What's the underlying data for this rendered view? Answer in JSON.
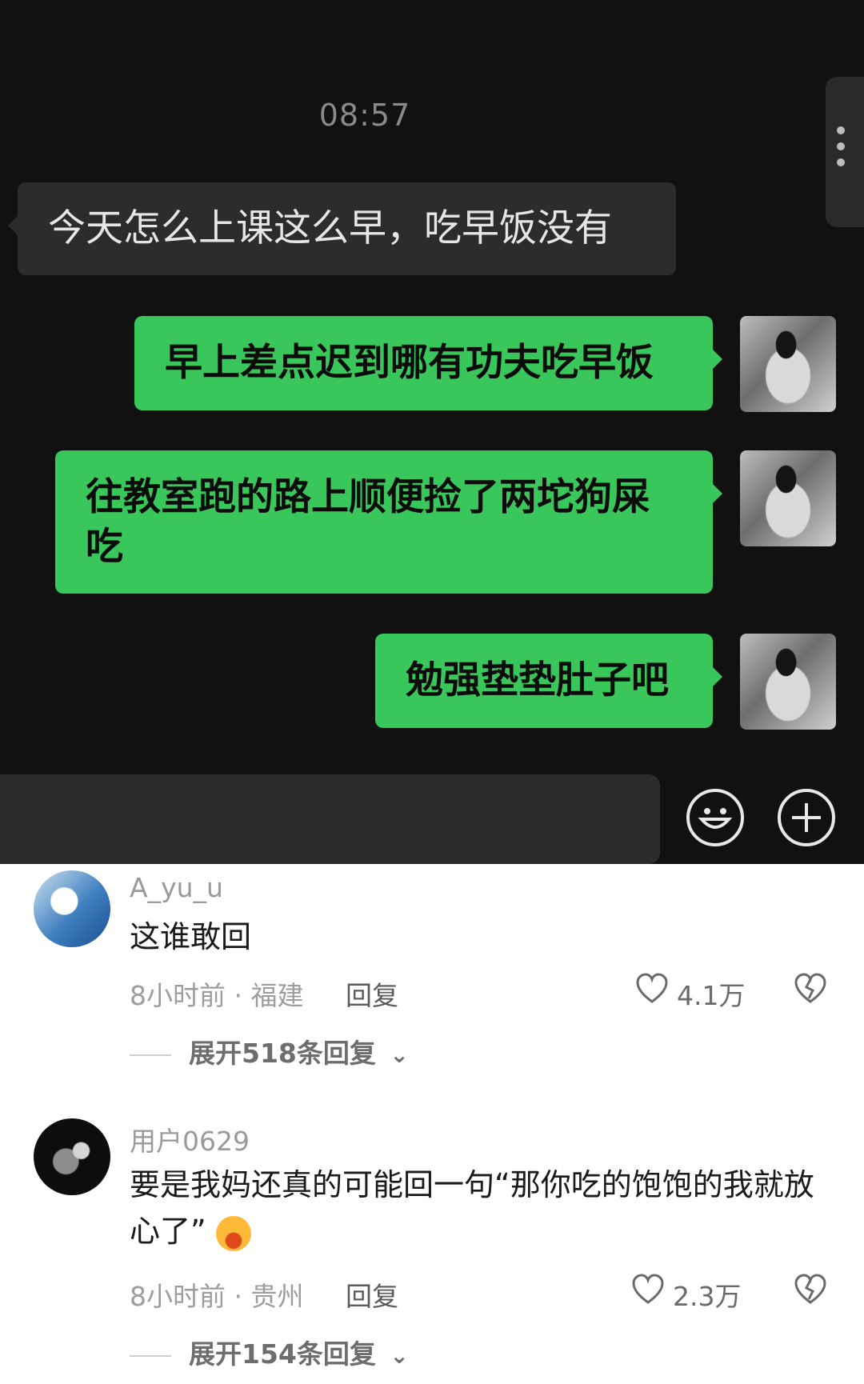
{
  "chat": {
    "time": "08:57",
    "messages": [
      {
        "side": "in",
        "text": "今天怎么上课这么早，吃早饭没有"
      },
      {
        "side": "out",
        "text": "早上差点迟到哪有功夫吃早饭"
      },
      {
        "side": "out",
        "text": "往教室跑的路上顺便捡了两坨狗屎吃"
      },
      {
        "side": "out",
        "text": "勉强垫垫肚子吧"
      }
    ],
    "composer": {
      "emoji_icon": "smiley-icon",
      "plus_icon": "plus-circle-icon"
    }
  },
  "comments": [
    {
      "user": "A_yu_u",
      "text": "这谁敢回",
      "meta": "8小时前 · 福建",
      "reply_label": "回复",
      "likes": "4.1万",
      "expand": "展开518条回复"
    },
    {
      "user": "用户0629",
      "text": "要是我妈还真的可能回一句“那你吃的饱饱的我就放心了”",
      "meta": "8小时前 · 贵州",
      "reply_label": "回复",
      "likes": "2.3万",
      "expand": "展开154条回复"
    }
  ],
  "colors": {
    "bubble_out": "#39c65a",
    "bubble_in": "#2c2c2c",
    "chat_bg": "#111111"
  }
}
